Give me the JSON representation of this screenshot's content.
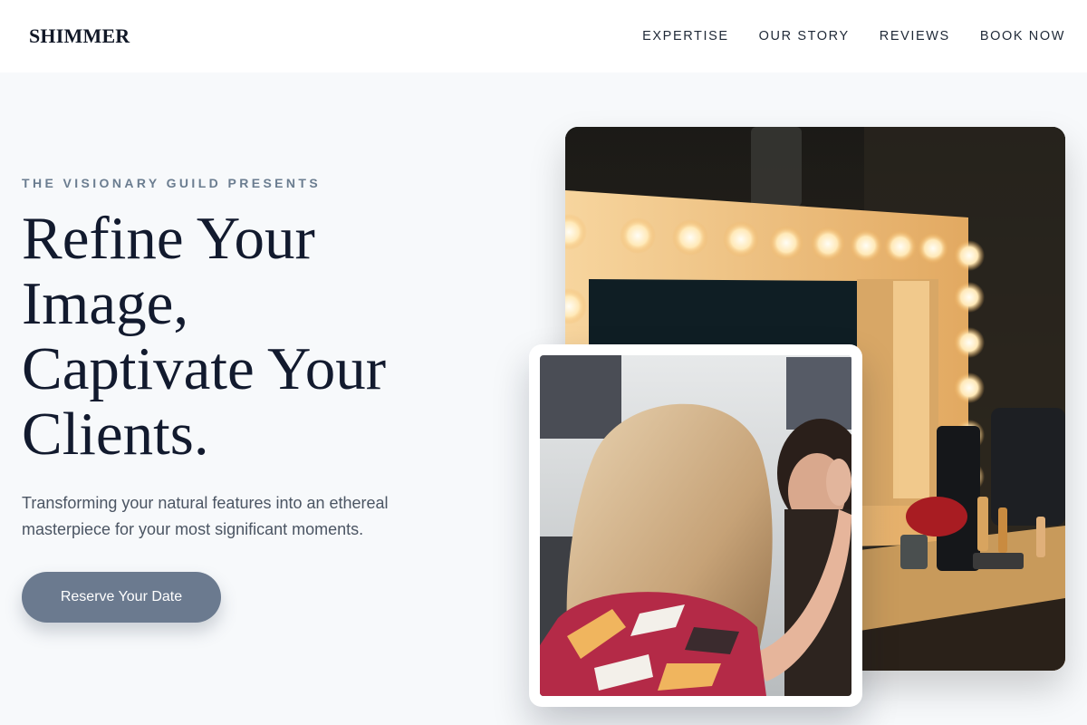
{
  "brand": {
    "logo": "SHIMMER"
  },
  "nav": {
    "items": [
      "EXPERTISE",
      "OUR STORY",
      "REVIEWS",
      "BOOK NOW"
    ]
  },
  "hero": {
    "eyebrow": "THE VISIONARY GUILD PRESENTS",
    "headline_lines": [
      "Refine Your",
      "Image,",
      "Captivate Your",
      "Clients."
    ],
    "subtitle": "Transforming your natural features into an ethereal masterpiece for your most significant moments.",
    "cta_label": "Reserve Your Date"
  },
  "colors": {
    "background": "#f7f9fb",
    "accent": "#6b7a8f",
    "heading": "#121a2e",
    "eyebrow": "#6b7d90"
  }
}
